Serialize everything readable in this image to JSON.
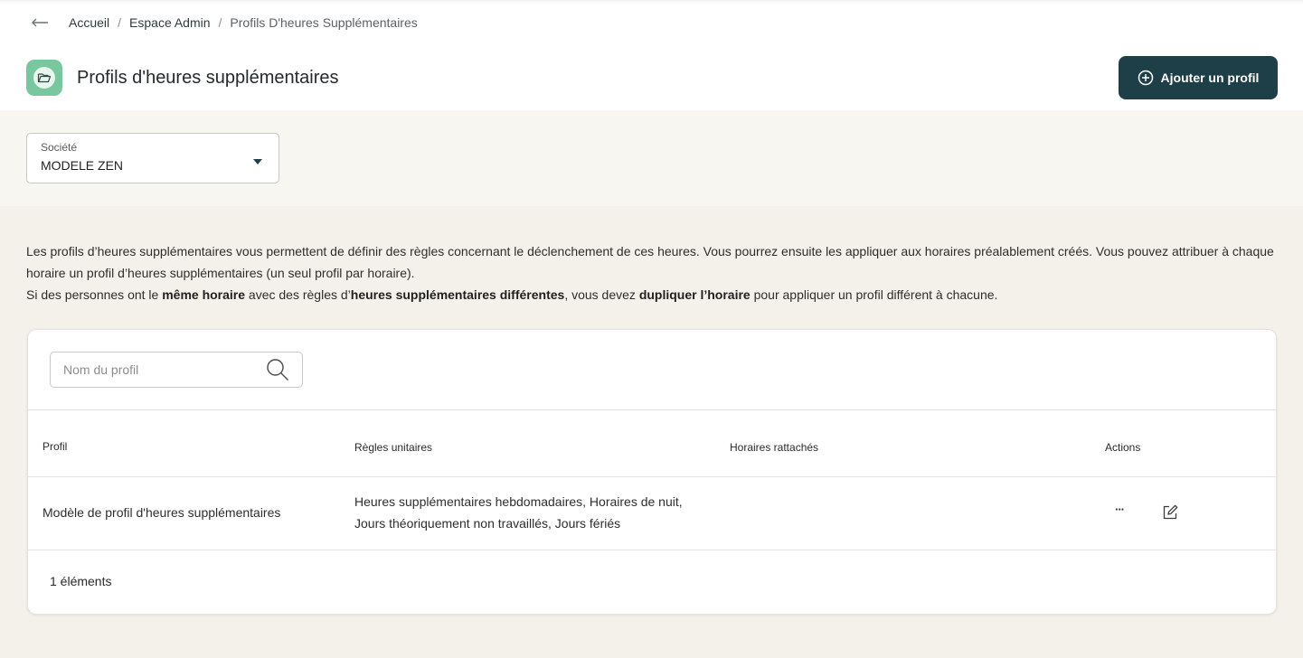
{
  "breadcrumb": {
    "items": [
      "Accueil",
      "Espace Admin",
      "Profils D'heures Supplémentaires"
    ],
    "separator": "/"
  },
  "header": {
    "title": "Profils d'heures supplémentaires",
    "add_button_label": "Ajouter un profil"
  },
  "filter": {
    "label": "Société",
    "value": "MODELE ZEN"
  },
  "description": {
    "p1": "Les profils d’heures supplémentaires vous permettent de définir des règles concernant le déclenchement de ces heures. Vous pourrez ensuite les appliquer aux horaires préalablement créés. Vous pouvez attribuer à chaque horaire un profil d’heures supplémentaires (un seul profil par horaire).",
    "p2_a": "Si des personnes ont le ",
    "p2_b": "même horaire",
    "p2_c": " avec des règles d’",
    "p2_d": "heures supplémentaires différentes",
    "p2_e": ", vous devez ",
    "p2_f": "dupliquer l’horaire",
    "p2_g": " pour appliquer un profil différent à chacune."
  },
  "search": {
    "placeholder": "Nom du profil"
  },
  "table": {
    "headers": {
      "profil": "Profil",
      "regles": "Règles unitaires",
      "horaires": "Horaires rattachés",
      "actions": "Actions"
    },
    "rows": [
      {
        "profil": "Modèle de profil d'heures supplémentaires",
        "regles_line1": "Heures supplémentaires hebdomadaires, Horaires de nuit,",
        "regles_line2": "Jours théoriquement non travaillés, Jours fériés",
        "horaires": "",
        "more_label": "···"
      }
    ],
    "count_label": "1 éléments"
  },
  "colors": {
    "accent": "#1f3f48",
    "icon_bg": "#78c79f",
    "page_bg": "#f4f1ea"
  },
  "icons": [
    "back-arrow-icon",
    "folder-open-icon",
    "plus-circle-icon",
    "caret-down-icon",
    "search-icon",
    "more-icon",
    "edit-icon"
  ]
}
